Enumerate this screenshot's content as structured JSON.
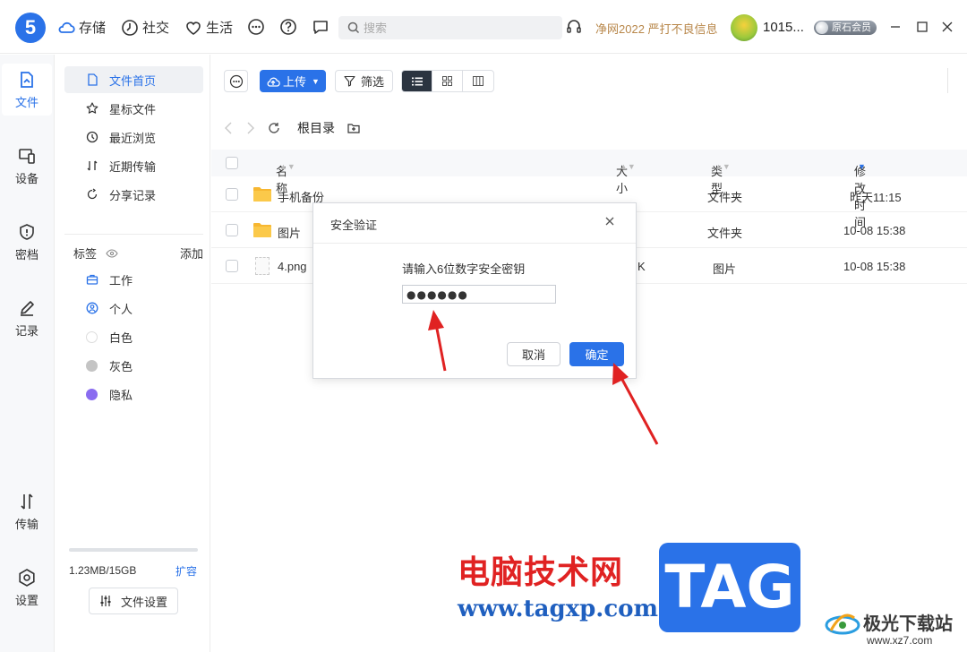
{
  "app": {
    "logo_text": "5"
  },
  "topnav": {
    "storage": "存储",
    "social": "社交",
    "life": "生活"
  },
  "search": {
    "placeholder": "搜索"
  },
  "promo": "净网2022 严打不良信息",
  "user": {
    "name": "1015...",
    "vip_label": "原石会员"
  },
  "rail": {
    "files": "文件",
    "devices": "设备",
    "vault": "密档",
    "notes": "记录",
    "transfer": "传输",
    "settings": "设置"
  },
  "sidebar": {
    "items": [
      {
        "label": "文件首页"
      },
      {
        "label": "星标文件"
      },
      {
        "label": "最近浏览"
      },
      {
        "label": "近期传输"
      },
      {
        "label": "分享记录"
      }
    ],
    "tags_title": "标签",
    "tags_add": "添加",
    "tags": [
      {
        "label": "工作"
      },
      {
        "label": "个人"
      },
      {
        "label": "白色",
        "color": "#ffffff"
      },
      {
        "label": "灰色",
        "color": "#c4c4c4"
      },
      {
        "label": "隐私",
        "color": "#8a6cf0"
      }
    ],
    "storage_used_fraction": 0.0,
    "storage_text": "1.23MB/15GB",
    "expand_label": "扩容",
    "file_settings": "文件设置"
  },
  "toolbar": {
    "upload_label": "上传",
    "filter_label": "筛选"
  },
  "path": {
    "crumb": "根目录"
  },
  "table": {
    "headers": {
      "name": "名称",
      "size": "大小",
      "type": "类型",
      "modified": "修改时间"
    },
    "rows": [
      {
        "name": "手机备份",
        "size": "",
        "type": "文件夹",
        "modified": "昨天11:15"
      },
      {
        "name": "图片",
        "size": "",
        "type": "文件夹",
        "modified": "10-08 15:38"
      },
      {
        "name": "4.png",
        "size": "K",
        "type": "图片",
        "modified": "10-08 15:38"
      }
    ]
  },
  "dialog": {
    "title": "安全验证",
    "prompt": "请输入6位数字安全密钥",
    "input_value": "●●●●●●",
    "cancel": "取消",
    "ok": "确定"
  },
  "watermark": {
    "cn": "电脑技术网",
    "url": "www.tagxp.com",
    "tag": "TAG",
    "jg": "极光下载站",
    "jg_url": "www.xz7.com"
  },
  "colors": {
    "accent": "#2a72e8",
    "promo": "#b8874a",
    "arrow": "#e02222"
  }
}
